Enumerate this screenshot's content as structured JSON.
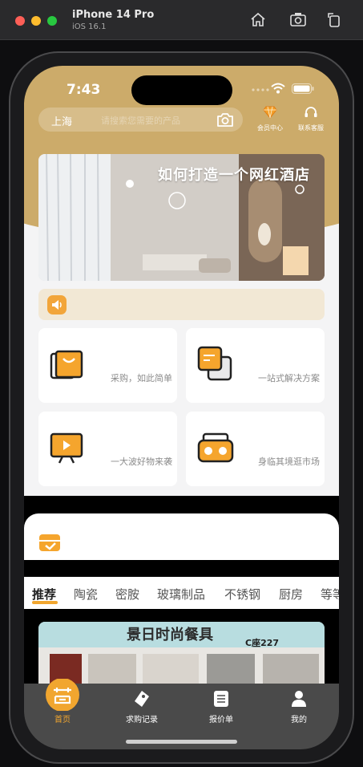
{
  "simulator": {
    "device": "iPhone 14 Pro",
    "os": "iOS 16.1"
  },
  "status_bar": {
    "time": "7:43"
  },
  "header": {
    "city": "上海",
    "search_placeholder": "请搜索您需要的产品",
    "member_center": "会员中心",
    "customer_service": "联系客服"
  },
  "banner": {
    "title": "如何打造一个网红酒店"
  },
  "features": [
    {
      "label": "采购，如此简单",
      "icon": "shopping-bag-icon"
    },
    {
      "label": "一站式解决方案",
      "icon": "layers-icon"
    },
    {
      "label": "一大波好物来袭",
      "icon": "video-screen-icon"
    },
    {
      "label": "身临其境逛市场",
      "icon": "vr-headset-icon"
    }
  ],
  "category_tabs": [
    "推荐",
    "陶瓷",
    "密胺",
    "玻璃制品",
    "不锈钢",
    "厨房",
    "等等"
  ],
  "product_photo": {
    "sign": "景日时尚餐具",
    "shop_no": "C座227"
  },
  "bottom_nav": [
    {
      "label": "首页",
      "icon": "home-logo-icon",
      "active": true
    },
    {
      "label": "求购记录",
      "icon": "tag-icon",
      "active": false
    },
    {
      "label": "报价单",
      "icon": "document-icon",
      "active": false
    },
    {
      "label": "我的",
      "icon": "person-icon",
      "active": false
    }
  ],
  "colors": {
    "brand_gold": "#ccab6a",
    "accent_orange": "#f1a62f",
    "nav_bg": "#4a4a4a"
  }
}
